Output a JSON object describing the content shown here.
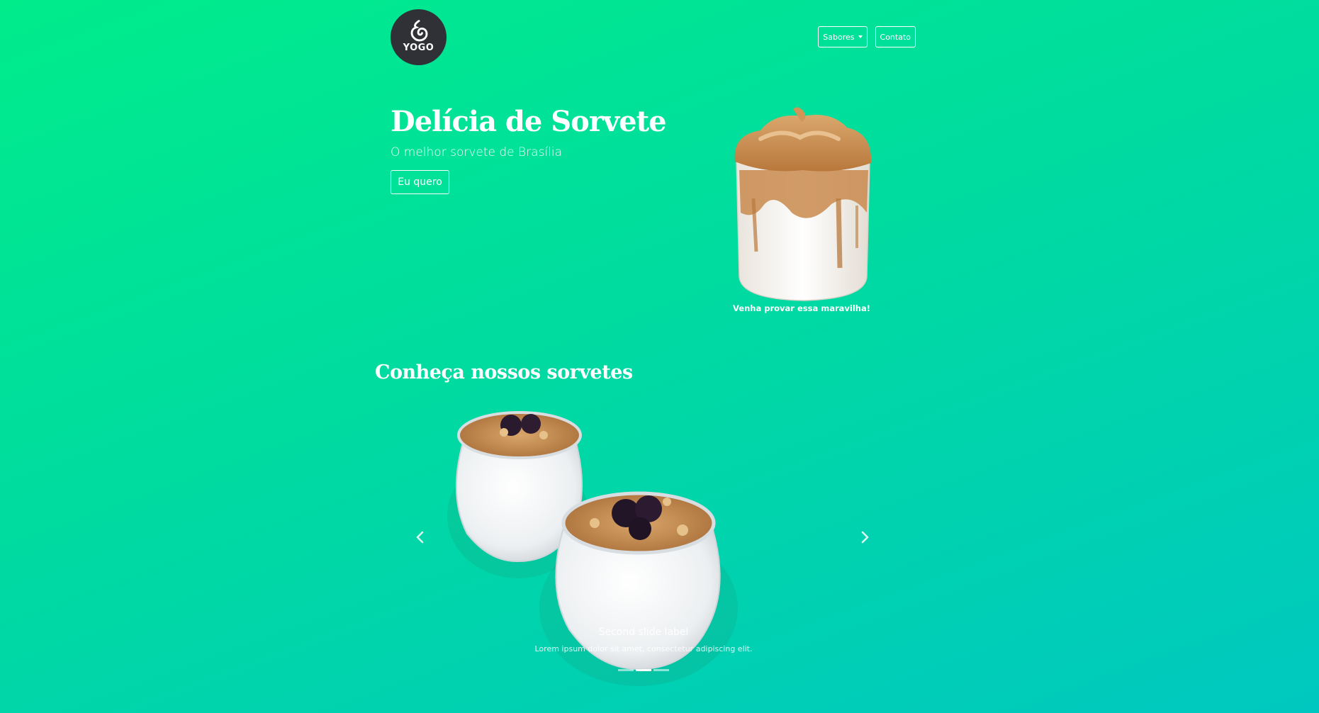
{
  "brand": {
    "logo_text": "YOGO"
  },
  "nav": {
    "flavors_label": "Sabores",
    "contact_label": "Contato"
  },
  "hero": {
    "title": "Delícia de Sorvete",
    "subtitle": "O melhor sorvete de Brasília",
    "cta_label": "Eu quero",
    "image_caption": "Venha provar essa maravilha!"
  },
  "section": {
    "title": "Conheça nossos sorvetes"
  },
  "carousel": {
    "slide_label": "Second slide label",
    "slide_text": "Lorem ipsum dolor sit amet, consectetur adipiscing elit.",
    "indicators": [
      {
        "active": false
      },
      {
        "active": true
      },
      {
        "active": false
      }
    ],
    "active_index": 1
  },
  "colors": {
    "gradient_start": "#00ec8b",
    "gradient_end": "#00c8c0",
    "logo_bg": "#2f3136",
    "text": "#ffffff"
  },
  "icons": {
    "logo": "swirl-icon",
    "prev": "chevron-left-icon",
    "next": "chevron-right-icon",
    "dropdown": "caret-down-icon"
  }
}
